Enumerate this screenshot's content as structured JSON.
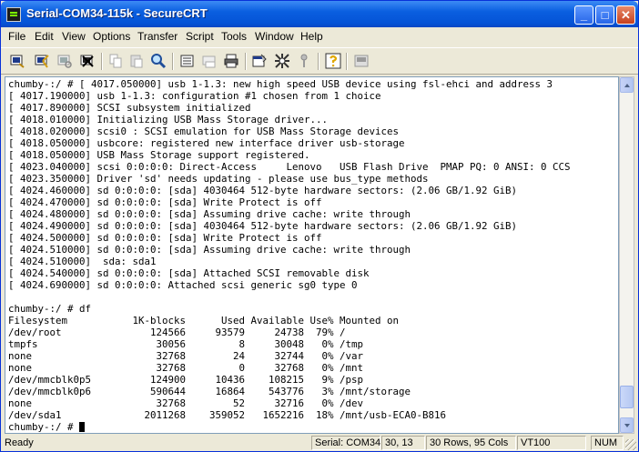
{
  "window": {
    "title": "Serial-COM34-115k - SecureCRT",
    "controls": {
      "minimize": "_",
      "maximize": "□",
      "close": "✕"
    }
  },
  "menu": [
    "File",
    "Edit",
    "View",
    "Options",
    "Transfer",
    "Script",
    "Tools",
    "Window",
    "Help"
  ],
  "toolbar": {
    "icons": [
      "connect-icon",
      "quick-connect-icon",
      "reconnect-icon",
      "disconnect-icon",
      "copy-icon",
      "paste-icon",
      "find-icon",
      "print-setup-icon",
      "print-screen-icon",
      "print-icon",
      "session-options-icon",
      "global-options-icon",
      "keymap-icon",
      "help-icon",
      "sftp-icon"
    ]
  },
  "terminal": {
    "lines": [
      "chumby-:/ # [ 4017.050000] usb 1-1.3: new high speed USB device using fsl-ehci and address 3",
      "[ 4017.190000] usb 1-1.3: configuration #1 chosen from 1 choice",
      "[ 4017.890000] SCSI subsystem initialized",
      "[ 4018.010000] Initializing USB Mass Storage driver...",
      "[ 4018.020000] scsi0 : SCSI emulation for USB Mass Storage devices",
      "[ 4018.050000] usbcore: registered new interface driver usb-storage",
      "[ 4018.050000] USB Mass Storage support registered.",
      "[ 4023.040000] scsi 0:0:0:0: Direct-Access     Lenovo   USB Flash Drive  PMAP PQ: 0 ANSI: 0 CCS",
      "[ 4023.350000] Driver 'sd' needs updating - please use bus_type methods",
      "[ 4024.460000] sd 0:0:0:0: [sda] 4030464 512-byte hardware sectors: (2.06 GB/1.92 GiB)",
      "[ 4024.470000] sd 0:0:0:0: [sda] Write Protect is off",
      "[ 4024.480000] sd 0:0:0:0: [sda] Assuming drive cache: write through",
      "[ 4024.490000] sd 0:0:0:0: [sda] 4030464 512-byte hardware sectors: (2.06 GB/1.92 GiB)",
      "[ 4024.500000] sd 0:0:0:0: [sda] Write Protect is off",
      "[ 4024.510000] sd 0:0:0:0: [sda] Assuming drive cache: write through",
      "[ 4024.510000]  sda: sda1",
      "[ 4024.540000] sd 0:0:0:0: [sda] Attached SCSI removable disk",
      "[ 4024.690000] sd 0:0:0:0: Attached scsi generic sg0 type 0",
      "",
      "chumby-:/ # df",
      "Filesystem           1K-blocks      Used Available Use% Mounted on",
      "/dev/root               124566     93579     24738  79% /",
      "tmpfs                    30056         8     30048   0% /tmp",
      "none                     32768        24     32744   0% /var",
      "none                     32768         0     32768   0% /mnt",
      "/dev/mmcblk0p5          124900     10436    108215   9% /psp",
      "/dev/mmcblk0p6          590644     16864    543776   3% /mnt/storage",
      "none                     32768        52     32716   0% /dev",
      "/dev/sda1              2011268    359052   1652216  18% /mnt/usb-ECA0-B816",
      "chumby-:/ # "
    ]
  },
  "scrollbar": {
    "position": 0.97,
    "visible_fraction": 0.07
  },
  "status": {
    "ready": "Ready",
    "connection": "Serial: COM34",
    "cursor": "30, 13",
    "size": "30 Rows, 95 Cols",
    "emulation": "VT100",
    "num": "NUM"
  },
  "colors": {
    "title_bar": "#0a5fe0",
    "terminal_bg": "#ffffff",
    "terminal_fg": "#000000",
    "chrome": "#ece9d8"
  }
}
